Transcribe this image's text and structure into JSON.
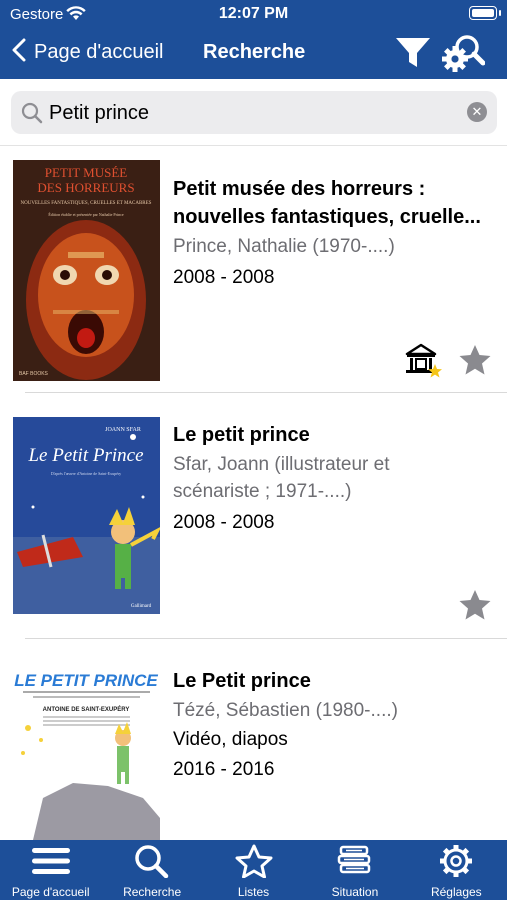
{
  "status_bar": {
    "carrier": "Gestore",
    "time": "12:07 PM"
  },
  "nav": {
    "back_label": "Page d'accueil",
    "title": "Recherche"
  },
  "search": {
    "value": "Petit prince",
    "placeholder": ""
  },
  "results": [
    {
      "title_line1": "Petit musée des horreurs :",
      "title_line2": "nouvelles fantastiques, cruelle...",
      "author": "Prince, Nathalie (1970-....)",
      "date": "2008 - 2008",
      "cover": {
        "title_line1": "PETIT MUSÉE",
        "title_line2": "DES HORREURS",
        "subtitle": "NOUVELLES FANTASTIQUES, CRUELLES ET MACABRES",
        "credit": "Édition établie et présentée par Nathalie Prince",
        "publisher": "BAF BOOKS"
      }
    },
    {
      "title_line1": "Le petit prince",
      "author_line1": "Sfar, Joann (illustrateur et",
      "author_line2": "scénariste ; 1971-....)",
      "date": "2008 - 2008",
      "cover": {
        "author": "JOANN SFAR",
        "title": "Le Petit Prince",
        "subtitle": "D'après l'œuvre d'Antoine de Saint-Exupéry",
        "publisher": "Gallimard"
      }
    },
    {
      "title_line1": "Le Petit prince",
      "author": "Tézé, Sébastien (1980-....)",
      "type": "Vidéo, diapos",
      "date": "2016 - 2016",
      "cover": {
        "title": "LE PETIT PRINCE",
        "author": "ANTOINE DE SAINT-EXUPÉRY"
      }
    }
  ],
  "tabbar": {
    "tabs": [
      {
        "label": "Page d'accueil",
        "icon": "menu-icon"
      },
      {
        "label": "Recherche",
        "icon": "search-icon"
      },
      {
        "label": "Listes",
        "icon": "star-icon"
      },
      {
        "label": "Situation",
        "icon": "books-icon"
      },
      {
        "label": "Réglages",
        "icon": "gear-icon"
      }
    ]
  },
  "colors": {
    "brand": "#1d4f99",
    "star": "#8a8a8f",
    "favorite_badge": "#f5c518"
  }
}
